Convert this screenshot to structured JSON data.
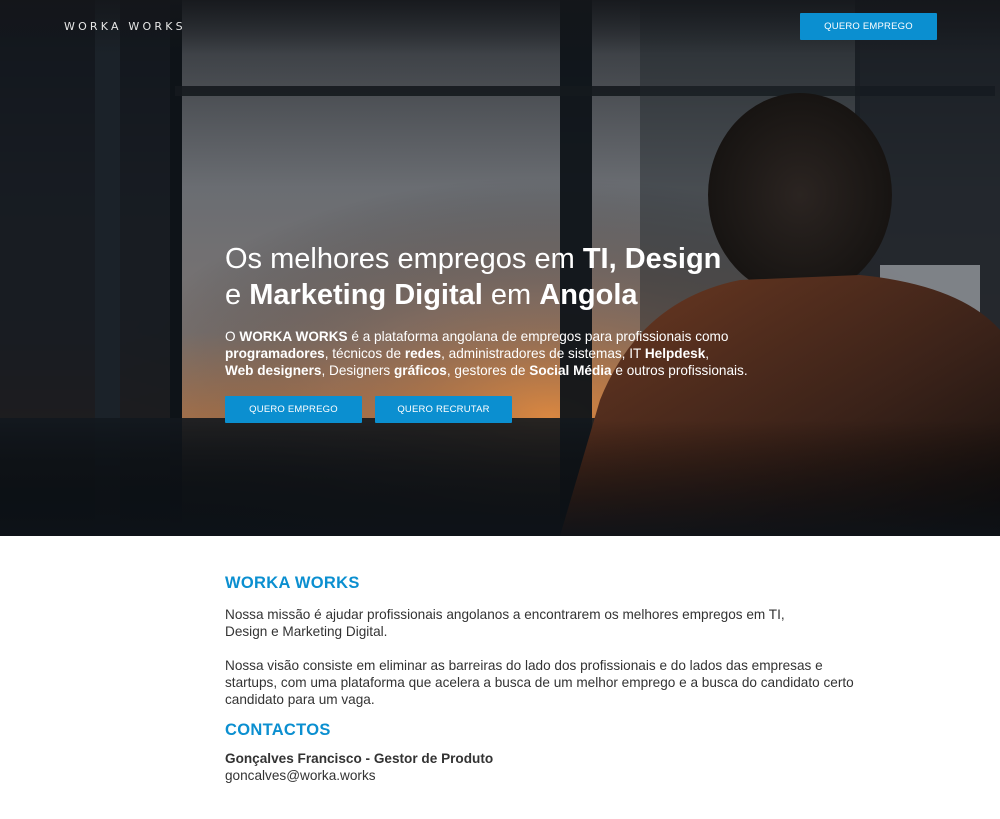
{
  "brand": {
    "logo": "WORKA WORKS"
  },
  "header": {
    "cta_label": "QUERO EMPREGO"
  },
  "hero": {
    "headline": {
      "l1_a": "Os melhores empregos em ",
      "l1_b": "TI, Design",
      "l2_a": "e ",
      "l2_b": "Marketing Digital",
      "l2_c": " em ",
      "l2_d": "Angola"
    },
    "lead": {
      "p1": "O ",
      "b1": "WORKA WORKS",
      "p2": " é a plataforma angolana de empregos para profissionais como",
      "b2": "programadores",
      "p3": ", técnicos de ",
      "b3": "redes",
      "p4": ", administradores de sistemas, IT ",
      "b4": "Helpdesk",
      "p5": ",",
      "b5": "Web designers",
      "p6": ", Designers ",
      "b6": "gráficos",
      "p7": ", gestores de ",
      "b7": "Social Média",
      "p8": " e outros profissionais."
    },
    "button_primary": "QUERO EMPREGO",
    "button_secondary": "QUERO RECRUTAR"
  },
  "about": {
    "title": "WORKA WORKS",
    "mission": "Nossa missão é ajudar profissionais angolanos a encontrarem os melhores empregos em TI, Design e Marketing Digital.",
    "vision": "Nossa visão consiste em eliminar as barreiras do lado dos profissionais e do lados das empresas e startups, com uma plataforma que acelera a busca de um melhor emprego e a busca do candidato certo candidato para um vaga."
  },
  "contacts": {
    "title": "CONTACTOS",
    "name": "Gonçalves Francisco - Gestor de Produto",
    "email": "goncalves@worka.works"
  },
  "colors": {
    "accent": "#0b8fd0",
    "hero_dark": "#1a1f27"
  }
}
